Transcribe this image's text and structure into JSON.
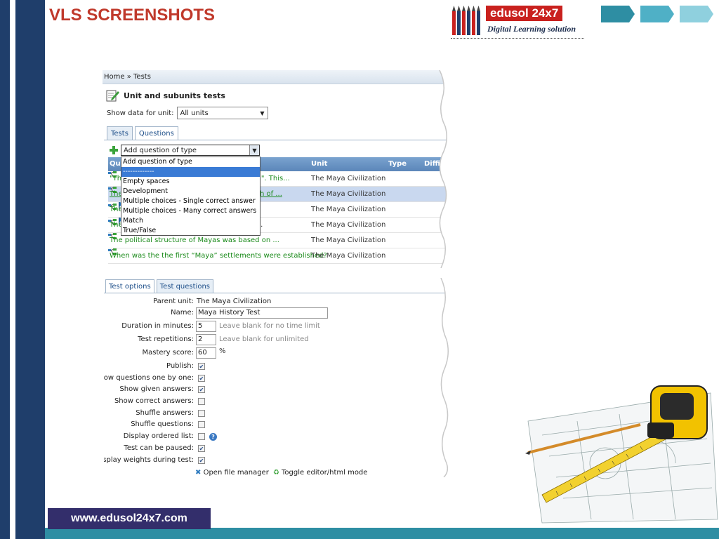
{
  "slide": {
    "title": "VLS SCREENSHOTS",
    "website": "www.edusol24x7.com",
    "colors": {
      "title": "#c0392b",
      "left_bar": "#1f3e6b",
      "bottom_bar": "#2e8ea3",
      "url_box": "#332e6b"
    }
  },
  "logo": {
    "brand": "edusol 24x7",
    "tagline": "Digital Learning solution"
  },
  "panel1": {
    "breadcrumb": "Home » Tests",
    "header_icon": "edit-document-icon",
    "title": "Unit and subunits tests",
    "unit_label": "Show data for unit:",
    "unit_value": "All units",
    "tabs": [
      "Tests",
      "Questions"
    ],
    "add_select_value": "Add question of type",
    "columns": [
      "Qu",
      "Unit",
      "Type",
      "Diffic"
    ],
    "dropdown_options": [
      "Add question of type",
      "-------------",
      "Empty spaces",
      "Development",
      "Multiple choices - Single correct answer",
      "Multiple choices - Many correct answers",
      "Match",
      "True/False"
    ],
    "rows": [
      {
        "question": "\"Th",
        "question_tail": "tem\". This...",
        "unit": "The Maya Civilization",
        "flag": false
      },
      {
        "question": "The",
        "question_tail": "h of ...",
        "unit": "The Maya Civilization",
        "flag": false
      },
      {
        "question": "The",
        "question_tail": "",
        "unit": "The Maya Civilization",
        "flag": true
      },
      {
        "question": "The",
        "question_tail": "..",
        "unit": "The Maya Civilization",
        "flag": true
      },
      {
        "question": "The political structure of Mayas was based on ...",
        "question_tail": "",
        "unit": "The Maya Civilization",
        "flag": false
      },
      {
        "question": "When was the the first “Maya” settlements were established?",
        "question_tail": "",
        "unit": "The Maya Civilization",
        "flag": false
      }
    ]
  },
  "panel2": {
    "tabs": [
      "Test options",
      "Test questions"
    ],
    "parent_unit_label": "Parent unit:",
    "parent_unit_value": "The Maya Civilization",
    "name_label": "Name:",
    "name_value": "Maya History Test",
    "duration_label": "Duration in minutes:",
    "duration_value": "5",
    "duration_hint": "Leave blank for no time limit",
    "repetitions_label": "Test repetitions:",
    "repetitions_value": "2",
    "repetitions_hint": "Leave blank for unlimited",
    "mastery_label": "Mastery score:",
    "mastery_value": "60",
    "mastery_unit": "%",
    "checkboxes": [
      {
        "label": "Publish:",
        "checked": true
      },
      {
        "label": "Show questions one by one:",
        "checked": true
      },
      {
        "label": "Show given answers:",
        "checked": true
      },
      {
        "label": "Show correct answers:",
        "checked": false
      },
      {
        "label": "Shuffle answers:",
        "checked": false
      },
      {
        "label": "Shuffle questions:",
        "checked": false
      },
      {
        "label": "Display ordered list:",
        "checked": false
      },
      {
        "label": "Test can be paused:",
        "checked": true
      },
      {
        "label": "Display weights during test:",
        "checked": true
      }
    ],
    "link_file_manager": "Open file manager",
    "link_toggle": "Toggle editor/html mode"
  }
}
